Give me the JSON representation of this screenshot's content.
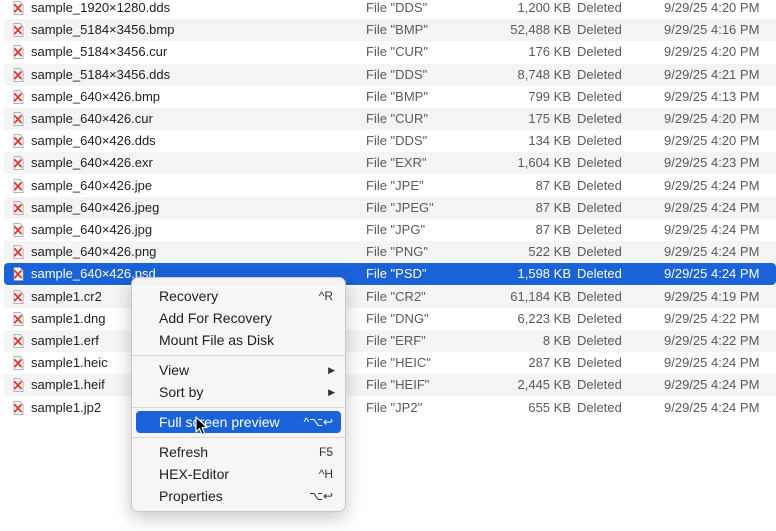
{
  "files": [
    {
      "name": "sample_1920×1280.dds",
      "type": "File \"DDS\"",
      "size": "1,200 KB",
      "status": "Deleted",
      "date": "9/29/25 4:20 PM"
    },
    {
      "name": "sample_5184×3456.bmp",
      "type": "File \"BMP\"",
      "size": "52,488 KB",
      "status": "Deleted",
      "date": "9/29/25 4:16 PM"
    },
    {
      "name": "sample_5184×3456.cur",
      "type": "File \"CUR\"",
      "size": "176 KB",
      "status": "Deleted",
      "date": "9/29/25 4:20 PM"
    },
    {
      "name": "sample_5184×3456.dds",
      "type": "File \"DDS\"",
      "size": "8,748 KB",
      "status": "Deleted",
      "date": "9/29/25 4:21 PM"
    },
    {
      "name": "sample_640×426.bmp",
      "type": "File \"BMP\"",
      "size": "799 KB",
      "status": "Deleted",
      "date": "9/29/25 4:13 PM"
    },
    {
      "name": "sample_640×426.cur",
      "type": "File \"CUR\"",
      "size": "175 KB",
      "status": "Deleted",
      "date": "9/29/25 4:20 PM"
    },
    {
      "name": "sample_640×426.dds",
      "type": "File \"DDS\"",
      "size": "134 KB",
      "status": "Deleted",
      "date": "9/29/25 4:20 PM"
    },
    {
      "name": "sample_640×426.exr",
      "type": "File \"EXR\"",
      "size": "1,604 KB",
      "status": "Deleted",
      "date": "9/29/25 4:23 PM"
    },
    {
      "name": "sample_640×426.jpe",
      "type": "File \"JPE\"",
      "size": "87 KB",
      "status": "Deleted",
      "date": "9/29/25 4:24 PM"
    },
    {
      "name": "sample_640×426.jpeg",
      "type": "File \"JPEG\"",
      "size": "87 KB",
      "status": "Deleted",
      "date": "9/29/25 4:24 PM"
    },
    {
      "name": "sample_640×426.jpg",
      "type": "File \"JPG\"",
      "size": "87 KB",
      "status": "Deleted",
      "date": "9/29/25 4:24 PM"
    },
    {
      "name": "sample_640×426.png",
      "type": "File \"PNG\"",
      "size": "522 KB",
      "status": "Deleted",
      "date": "9/29/25 4:24 PM"
    },
    {
      "name": "sample_640×426.psd",
      "type": "File \"PSD\"",
      "size": "1,598 KB",
      "status": "Deleted",
      "date": "9/29/25 4:24 PM",
      "selected": true
    },
    {
      "name": "sample1.cr2",
      "type": "File \"CR2\"",
      "size": "61,184 KB",
      "status": "Deleted",
      "date": "9/29/25 4:19 PM"
    },
    {
      "name": "sample1.dng",
      "type": "File \"DNG\"",
      "size": "6,223 KB",
      "status": "Deleted",
      "date": "9/29/25 4:22 PM"
    },
    {
      "name": "sample1.erf",
      "type": "File \"ERF\"",
      "size": "8 KB",
      "status": "Deleted",
      "date": "9/29/25 4:22 PM"
    },
    {
      "name": "sample1.heic",
      "type": "File \"HEIC\"",
      "size": "287 KB",
      "status": "Deleted",
      "date": "9/29/25 4:24 PM"
    },
    {
      "name": "sample1.heif",
      "type": "File \"HEIF\"",
      "size": "2,445 KB",
      "status": "Deleted",
      "date": "9/29/25 4:24 PM"
    },
    {
      "name": "sample1.jp2",
      "type": "File \"JP2\"",
      "size": "655 KB",
      "status": "Deleted",
      "date": "9/29/25 4:24 PM"
    }
  ],
  "file_icon": "deleted-file-icon",
  "context_menu": {
    "recovery": {
      "label": "Recovery",
      "shortcut": "^R"
    },
    "add_for_recovery": {
      "label": "Add For Recovery",
      "shortcut": ""
    },
    "mount_file": {
      "label": "Mount File as Disk",
      "shortcut": ""
    },
    "view": {
      "label": "View",
      "submenu": true
    },
    "sort_by": {
      "label": "Sort by",
      "submenu": true
    },
    "full_screen_preview": {
      "label": "Full screen preview",
      "shortcut": "^⌥↩",
      "highlighted": true
    },
    "refresh": {
      "label": "Refresh",
      "shortcut": "F5"
    },
    "hex_editor": {
      "label": "HEX-Editor",
      "shortcut": "^H"
    },
    "properties": {
      "label": "Properties",
      "shortcut": "⌥↩"
    }
  },
  "colors": {
    "selection": "#1a62d8",
    "deleted_mark": "#d93a2b",
    "alt_row": "#f4f4f5"
  }
}
